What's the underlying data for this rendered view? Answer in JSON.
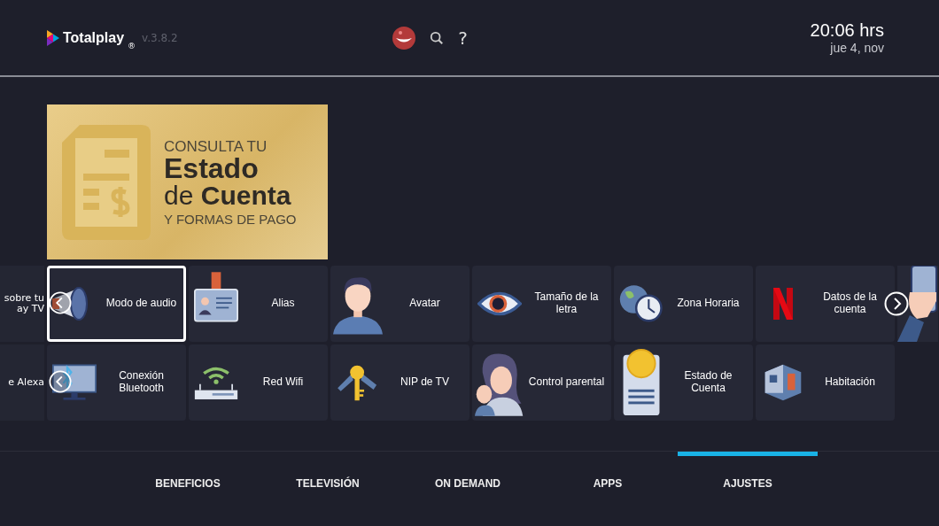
{
  "header": {
    "brand": "Totalplay",
    "trademark": "®",
    "version": "v.3.8.2",
    "help": "?",
    "time": "20:06 hrs",
    "date": "jue 4, nov"
  },
  "banner": {
    "kicker": "CONSULTA TU",
    "title": "Estado",
    "subtitle": "de **Cuenta**",
    "footer": "Y FORMAS DE PAGO"
  },
  "settings_rows": [
    {
      "partial_label": "sobre tu\nay TV",
      "tiles": [
        {
          "label": "Modo de audio",
          "focused": true
        },
        {
          "label": "Alias",
          "focused": false
        },
        {
          "label": "Avatar",
          "focused": false
        },
        {
          "label": "Tamaño de la\nletra",
          "focused": false
        },
        {
          "label": "Zona Horaria",
          "focused": false
        },
        {
          "label": "Datos de la\ncuenta",
          "focused": false
        }
      ],
      "has_next": true,
      "has_trailing_tile": true
    },
    {
      "partial_label": "e Alexa",
      "tiles": [
        {
          "label": "Conexión\nBluetooth",
          "focused": false
        },
        {
          "label": "Red Wifi",
          "focused": false
        },
        {
          "label": "NIP de TV",
          "focused": false
        },
        {
          "label": "Control parental",
          "focused": false
        },
        {
          "label": "Estado de Cuenta",
          "focused": false
        },
        {
          "label": "Habitación",
          "focused": false
        }
      ],
      "has_next": false,
      "has_trailing_tile": false
    }
  ],
  "nav_tabs": [
    {
      "label": "BENEFICIOS",
      "selected": false
    },
    {
      "label": "TELEVISIÓN",
      "selected": false
    },
    {
      "label": "ON DEMAND",
      "selected": false
    },
    {
      "label": "APPS",
      "selected": false
    },
    {
      "label": "AJUSTES",
      "selected": true
    }
  ]
}
